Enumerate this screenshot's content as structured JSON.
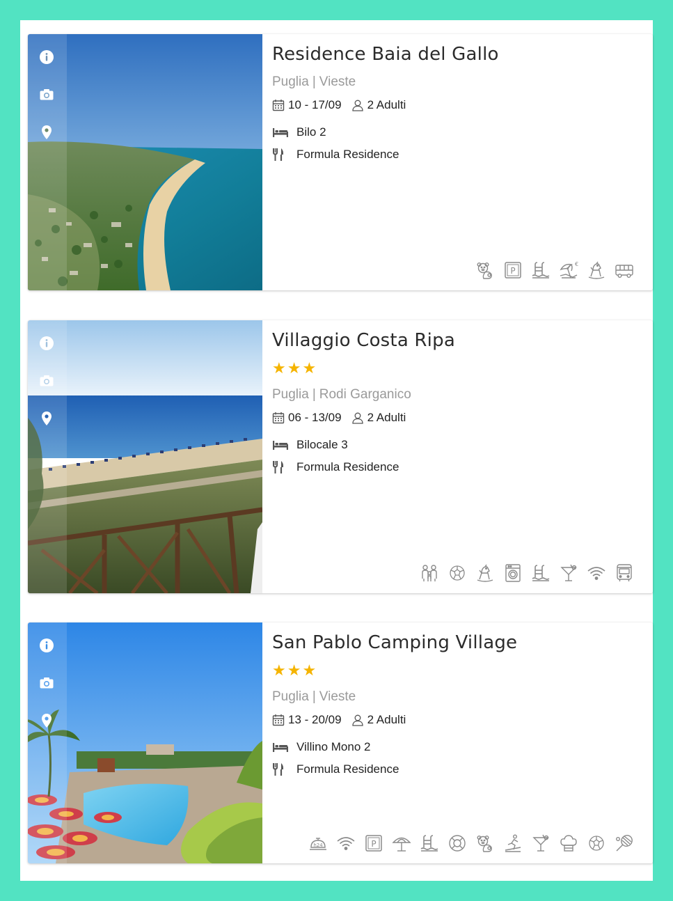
{
  "listings": [
    {
      "title": "Residence Baia del Gallo",
      "stars": "",
      "region": "Puglia",
      "separator": "|",
      "town": "Vieste",
      "dates": "10 - 17/09",
      "guests": "2 Adulti",
      "room": "Bilo 2",
      "board": "Formula Residence",
      "side_icons": [
        "info-icon",
        "camera-icon",
        "map-pin-icon"
      ],
      "amenities": [
        "pets-icon",
        "parking-icon",
        "pool-icon",
        "beach-umbrella-paid-icon",
        "kids-playground-icon",
        "shuttle-bus-icon"
      ]
    },
    {
      "title": "Villaggio Costa Ripa",
      "stars": "★★★",
      "region": "Puglia",
      "separator": "|",
      "town": "Rodi Garganico",
      "dates": "06 - 13/09",
      "guests": "2 Adulti",
      "room": "Bilocale 3",
      "board": "Formula Residence",
      "side_icons": [
        "info-icon",
        "camera-icon",
        "map-pin-icon"
      ],
      "amenities": [
        "family-icon",
        "football-icon",
        "kids-playground-icon",
        "washing-machine-icon",
        "pool-icon",
        "bar-cocktail-icon",
        "wifi-icon",
        "bus-icon"
      ]
    },
    {
      "title": "San Pablo Camping Village",
      "stars": "★★★",
      "region": "Puglia",
      "separator": "|",
      "town": "Vieste",
      "dates": "13 - 20/09",
      "guests": "2 Adulti",
      "room": "Villino Mono 2",
      "board": "Formula Residence",
      "side_icons": [
        "info-icon",
        "camera-icon",
        "map-pin-icon"
      ],
      "amenities": [
        "reception-24h-icon",
        "wifi-icon",
        "parking-icon",
        "beach-umbrella-icon",
        "pool-icon",
        "lifebuoy-icon",
        "pets-icon",
        "fitness-icon",
        "bar-cocktail-icon",
        "restaurant-chef-icon",
        "football-icon",
        "tennis-icon"
      ]
    }
  ],
  "amenity_labels": {
    "reception_24h": "h24",
    "parking": "P",
    "paid": "€"
  },
  "colors": {
    "frame": "#52e3c2",
    "stars": "#f5b400",
    "location": "#9a9a9a",
    "icon_gray": "#8a8a8a"
  }
}
